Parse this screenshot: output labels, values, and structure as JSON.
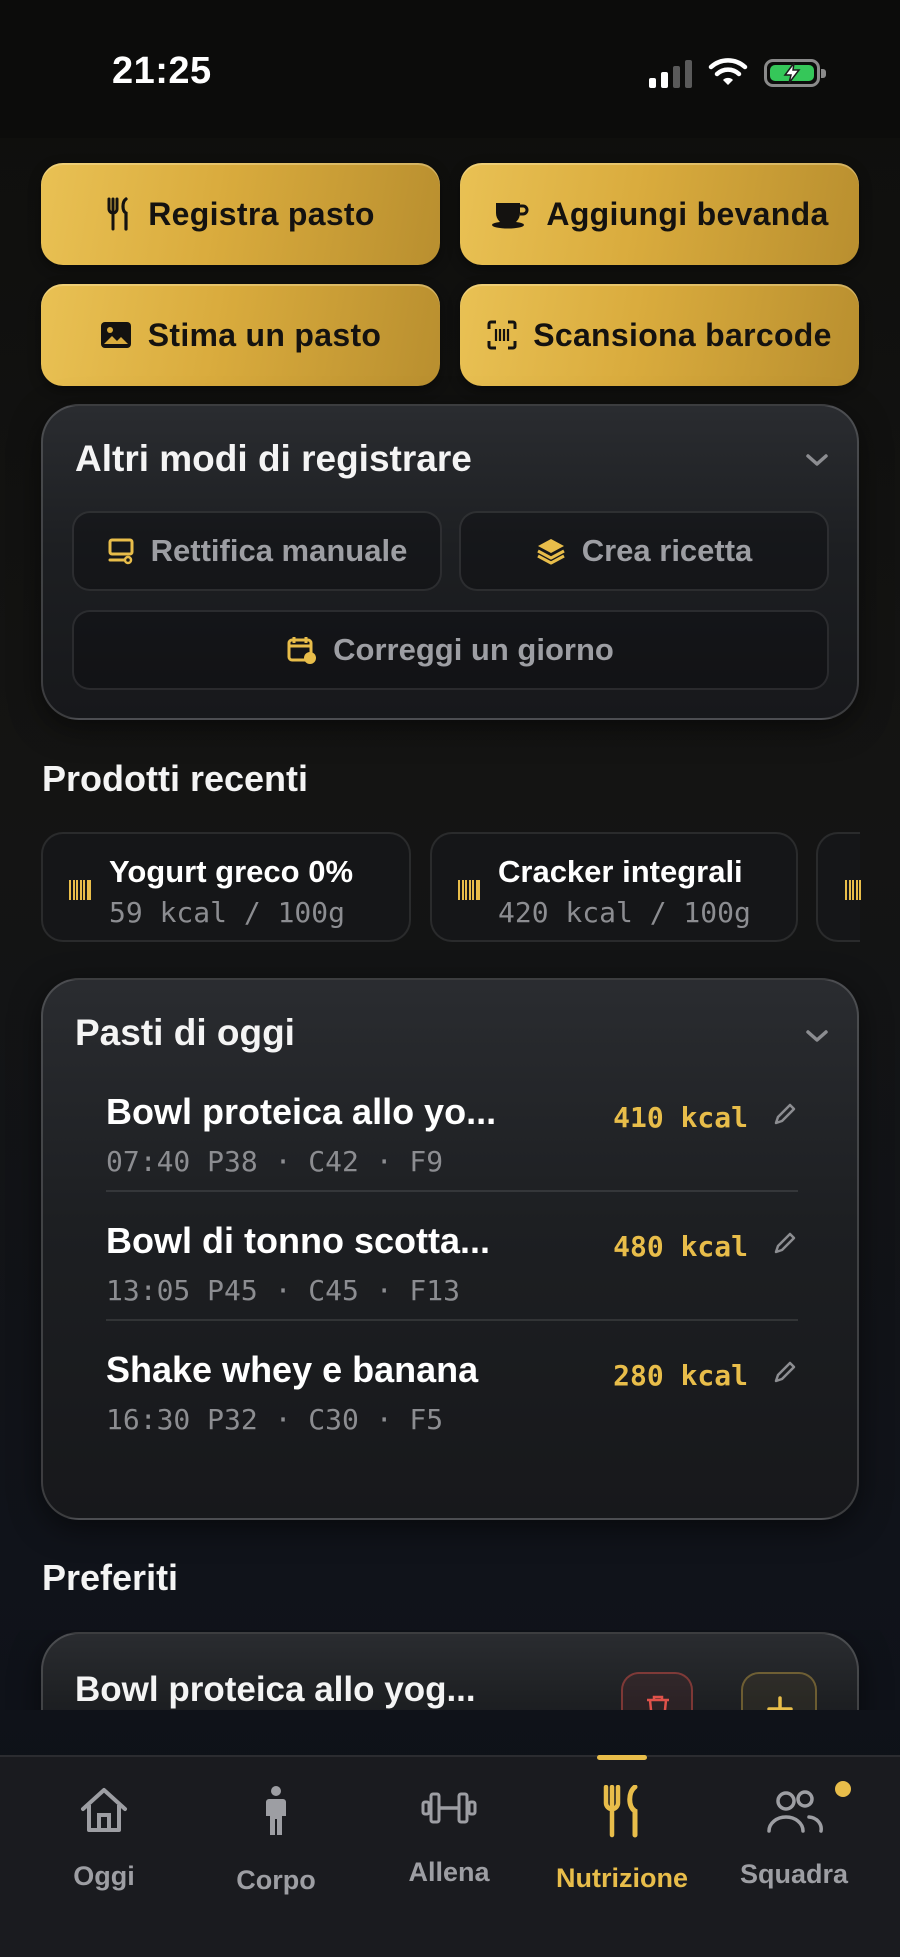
{
  "status_bar": {
    "time": "21:25"
  },
  "quick_actions": {
    "log_meal": "Registra pasto",
    "add_drink": "Aggiungi bevanda",
    "estimate_meal": "Stima un pasto",
    "scan_barcode": "Scansiona barcode"
  },
  "other_ways": {
    "title": "Altri modi di registrare",
    "manual_adjust": "Rettifica manuale",
    "create_recipe": "Crea ricetta",
    "fix_day": "Correggi un giorno"
  },
  "recent_products": {
    "title": "Prodotti recenti",
    "items": [
      {
        "name": "Yogurt greco 0%",
        "kcal": "59 kcal / 100g"
      },
      {
        "name": "Cracker integrali",
        "kcal": "420 kcal / 100g"
      }
    ]
  },
  "todays_meals": {
    "title": "Pasti di oggi",
    "items": [
      {
        "name": "Bowl proteica allo yo...",
        "meta": "07:40 P38 · C42 · F9",
        "kcal": "410 kcal"
      },
      {
        "name": "Bowl di tonno scotta...",
        "meta": "13:05 P45 · C45 · F13",
        "kcal": "480 kcal"
      },
      {
        "name": "Shake whey e banana",
        "meta": "16:30 P32 · C30 · F5",
        "kcal": "280 kcal"
      }
    ]
  },
  "favorites": {
    "title": "Preferiti",
    "items": [
      {
        "name": "Bowl proteica allo yog..."
      }
    ]
  },
  "tabbar": {
    "items": [
      {
        "label": "Oggi"
      },
      {
        "label": "Corpo"
      },
      {
        "label": "Allena"
      },
      {
        "label": "Nutrizione"
      },
      {
        "label": "Squadra"
      }
    ],
    "active": "Nutrizione"
  },
  "colors": {
    "accent": "#e8bd4a",
    "danger": "#e0524a",
    "battery": "#35c759"
  }
}
